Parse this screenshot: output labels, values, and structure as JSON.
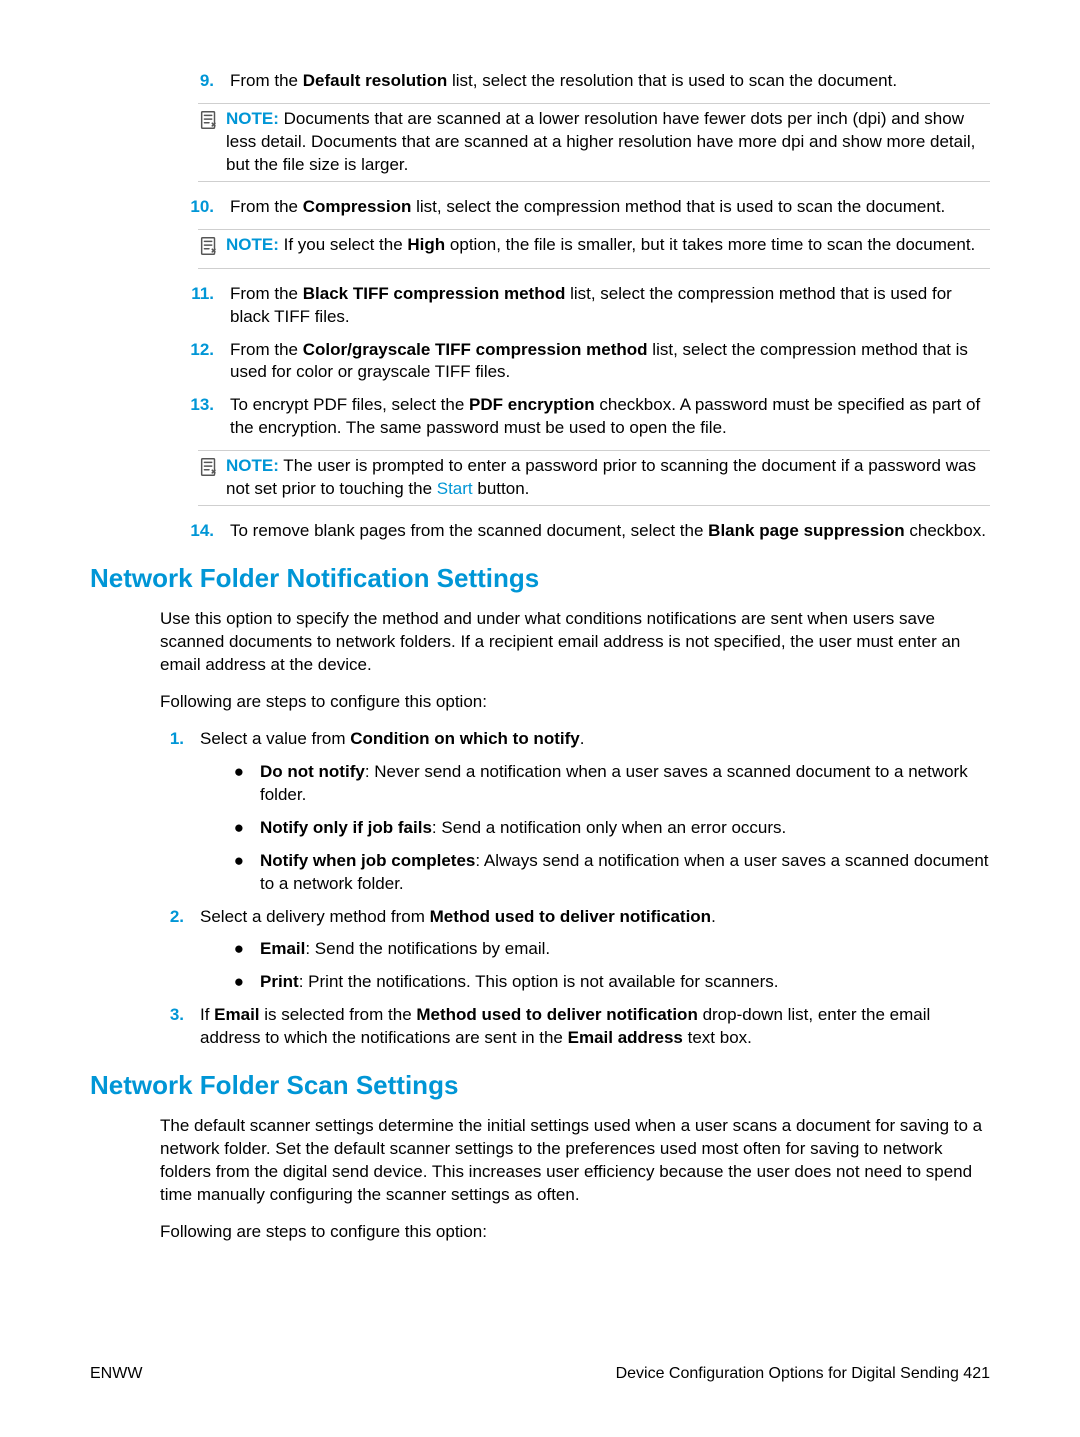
{
  "steps_top": {
    "9": {
      "num": "9.",
      "text_before": "From the ",
      "bold1": "Default resolution",
      "text_after": " list, select the resolution that is used to scan the document."
    },
    "note9": {
      "label": "NOTE:",
      "text": "   Documents that are scanned at a lower resolution have fewer dots per inch (dpi) and show less detail. Documents that are scanned at a higher resolution have more dpi and show more detail, but the file size is larger."
    },
    "10": {
      "num": "10.",
      "text_before": "From the ",
      "bold1": "Compression",
      "text_after": " list, select the compression method that is used to scan the document."
    },
    "note10": {
      "label": "NOTE:",
      "text_before": "   If you select the ",
      "bold1": "High",
      "text_after": " option, the file is smaller, but it takes more time to scan the document."
    },
    "11": {
      "num": "11.",
      "text_before": "From the ",
      "bold1": "Black TIFF compression method",
      "text_after": " list, select the compression method that is used for black TIFF files."
    },
    "12": {
      "num": "12.",
      "text_before": "From the ",
      "bold1": "Color/grayscale TIFF compression method",
      "text_after": " list, select the compression method that is used for color or grayscale TIFF files."
    },
    "13": {
      "num": "13.",
      "text_before": "To encrypt PDF files, select the ",
      "bold1": "PDF encryption",
      "text_after": " checkbox. A password must be specified as part of the encryption. The same password must be used to open the file."
    },
    "note13": {
      "label": "NOTE:",
      "text_before": "   The user is prompted to enter a password prior to scanning the document if a password was not set prior to touching the ",
      "link": "Start",
      "text_after": " button."
    },
    "14": {
      "num": "14.",
      "text_before": "To remove blank pages from the scanned document, select the ",
      "bold1": "Blank page suppression",
      "text_after": " checkbox."
    }
  },
  "section1": {
    "title": "Network Folder Notification Settings",
    "intro": "Use this option to specify the method and under what conditions notifications are sent when users save scanned documents to network folders. If a recipient email address is not specified, the user must enter an email address at the device.",
    "following": "Following are steps to configure this option:",
    "step1": {
      "num": "1.",
      "text_before": "Select a value from ",
      "bold1": "Condition on which to notify",
      "text_after": "."
    },
    "b1": {
      "bold": "Do not notify",
      "text": ": Never send a notification when a user saves a scanned document to a network folder."
    },
    "b2": {
      "bold": "Notify only if job fails",
      "text": ": Send a notification only when an error occurs."
    },
    "b3": {
      "bold": "Notify when job completes",
      "text": ": Always send a notification when a user saves a scanned document to a network folder."
    },
    "step2": {
      "num": "2.",
      "text_before": "Select a delivery method from ",
      "bold1": "Method used to deliver notification",
      "text_after": "."
    },
    "b4": {
      "bold": "Email",
      "text": ": Send the notifications by email."
    },
    "b5": {
      "bold": "Print",
      "text": ": Print the notifications. This option is not available for scanners."
    },
    "step3": {
      "num": "3.",
      "t1": "If ",
      "b1": "Email",
      "t2": " is selected from the ",
      "b2": "Method used to deliver notification",
      "t3": " drop-down list, enter the email address to which the notifications are sent in the ",
      "b3": "Email address",
      "t4": " text box."
    }
  },
  "section2": {
    "title": "Network Folder Scan Settings",
    "intro": "The default scanner settings determine the initial settings used when a user scans a document for saving to a network folder. Set the default scanner settings to the preferences used most often for saving to network folders from the digital send device. This increases user efficiency because the user does not need to spend time manually configuring the scanner settings as often.",
    "following": "Following are steps to configure this option:"
  },
  "footer": {
    "left": "ENWW",
    "right": "Device Configuration Options for Digital Sending    421"
  }
}
